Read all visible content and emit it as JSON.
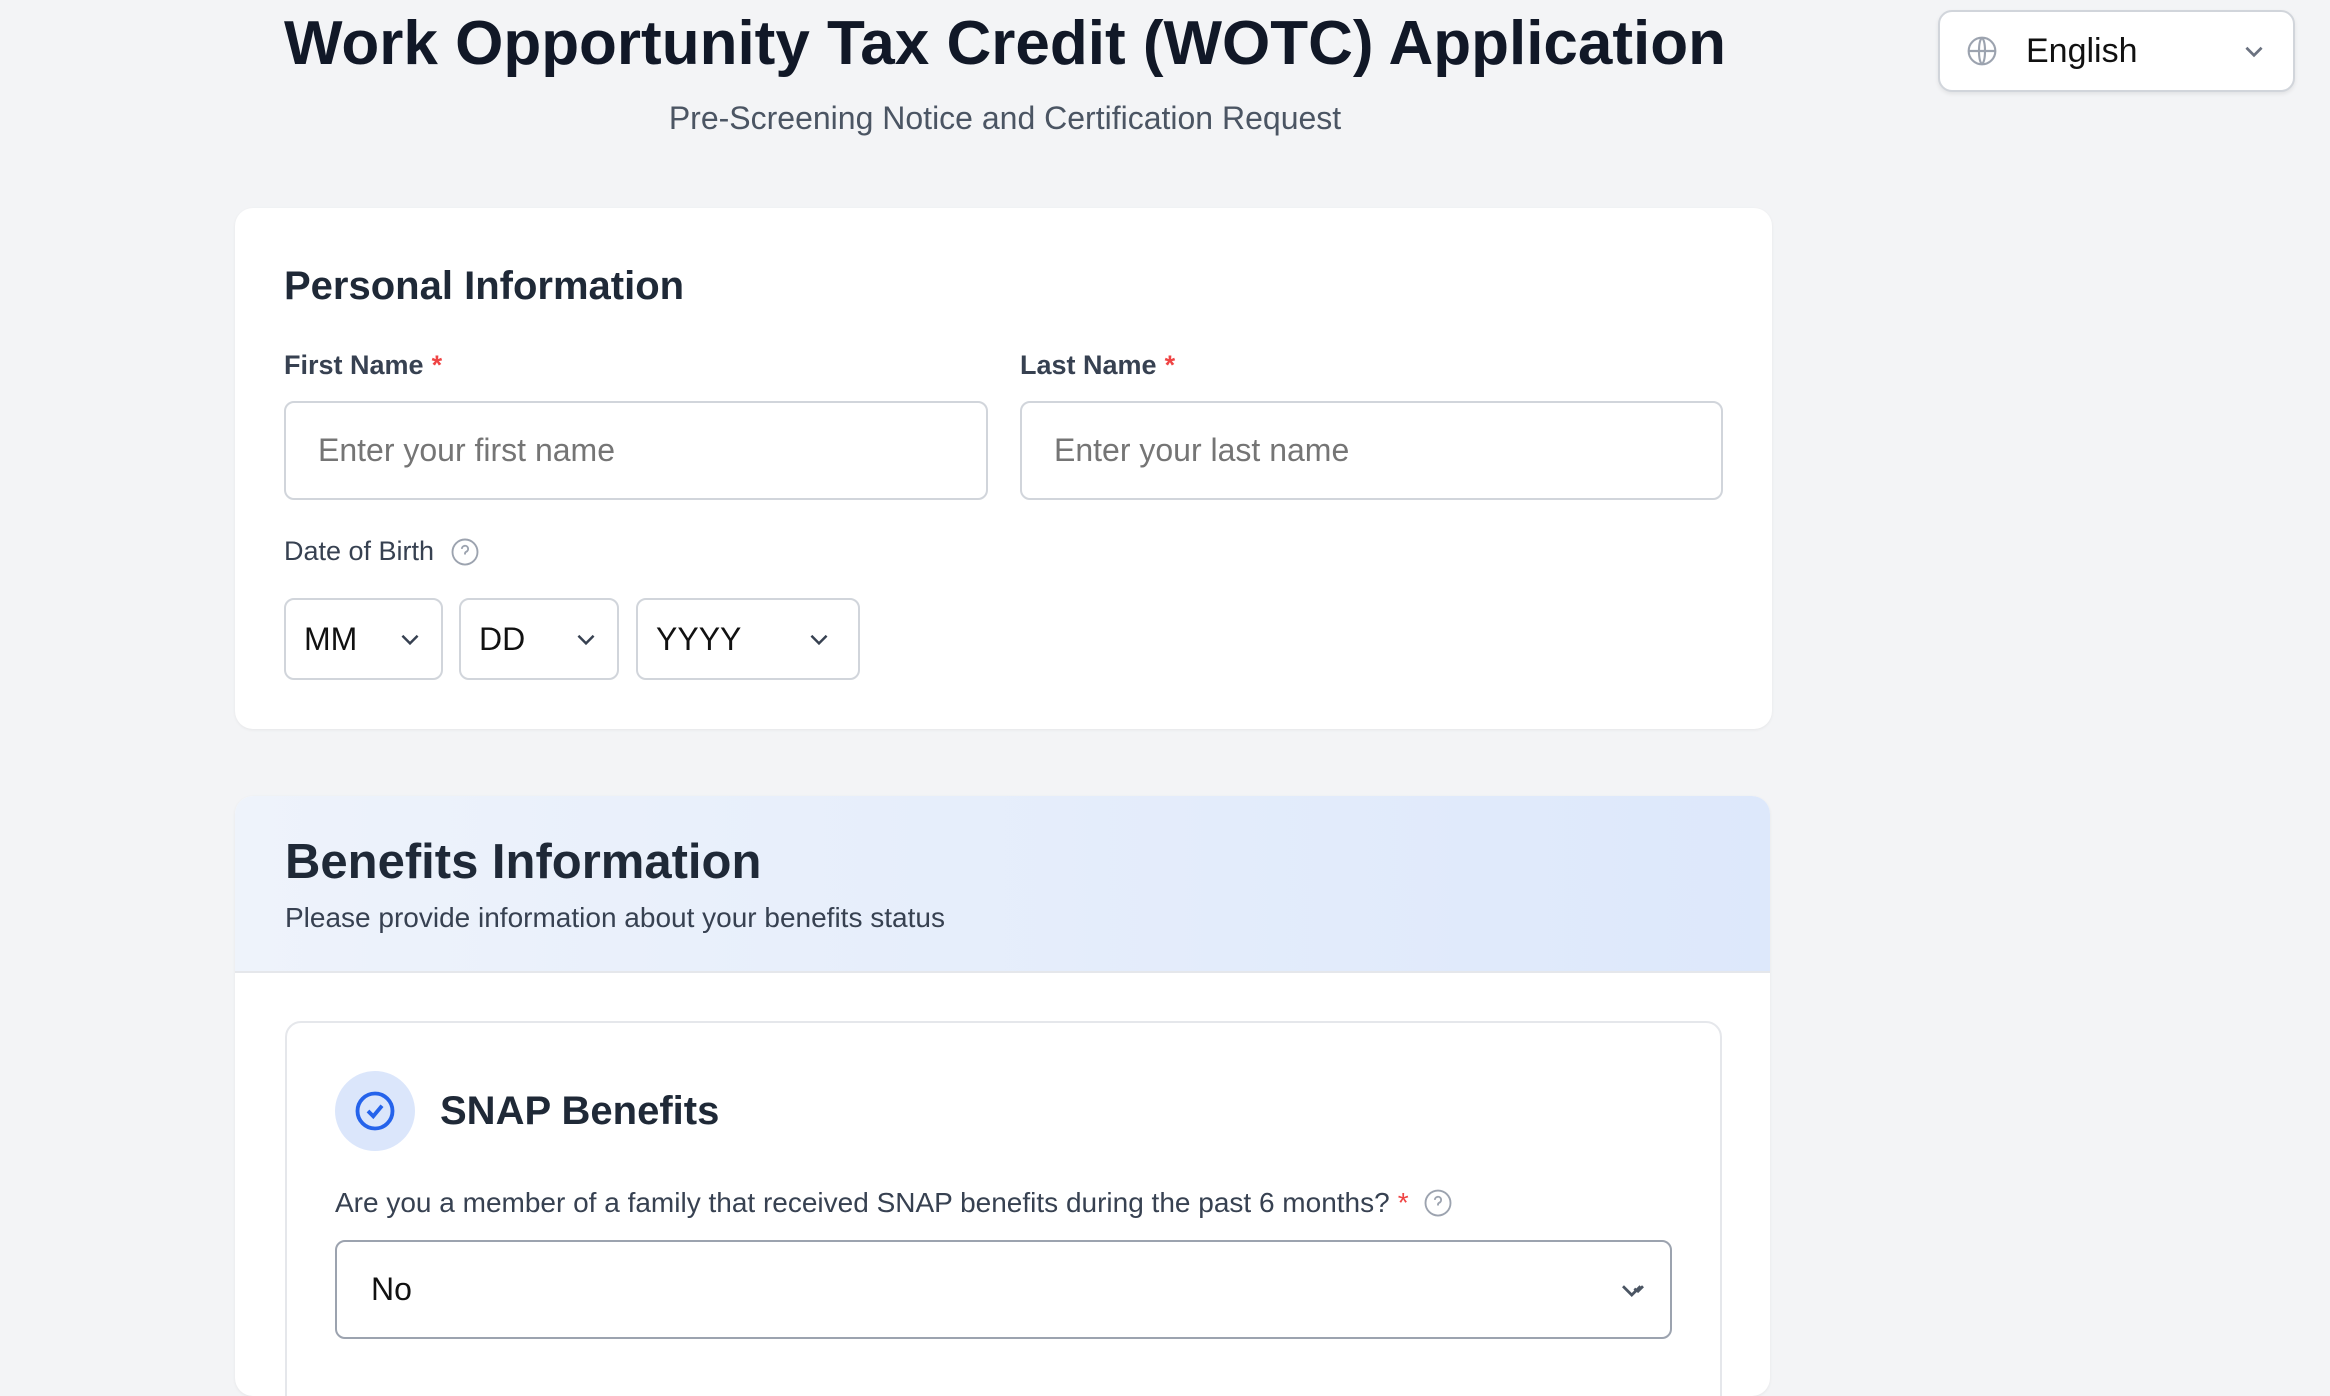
{
  "header": {
    "title": "Work Opportunity Tax Credit (WOTC) Application",
    "subtitle": "Pre-Screening Notice and Certification Request"
  },
  "language": {
    "selected": "English",
    "icon": "globe-icon"
  },
  "personal": {
    "title": "Personal Information",
    "first_name": {
      "label": "First Name",
      "required": "*",
      "placeholder": "Enter your first name"
    },
    "last_name": {
      "label": "Last Name",
      "required": "*",
      "placeholder": "Enter your last name"
    },
    "dob": {
      "label": "Date of Birth",
      "month": "MM",
      "day": "DD",
      "year": "YYYY"
    }
  },
  "benefits": {
    "title": "Benefits Information",
    "subtitle": "Please provide information about your benefits status",
    "snap": {
      "title": "SNAP Benefits",
      "question": "Are you a member of a family that received SNAP benefits during the past 6 months?",
      "required": "*",
      "value": "No"
    }
  },
  "colors": {
    "accent": "#2563eb",
    "required": "#ef4444"
  }
}
